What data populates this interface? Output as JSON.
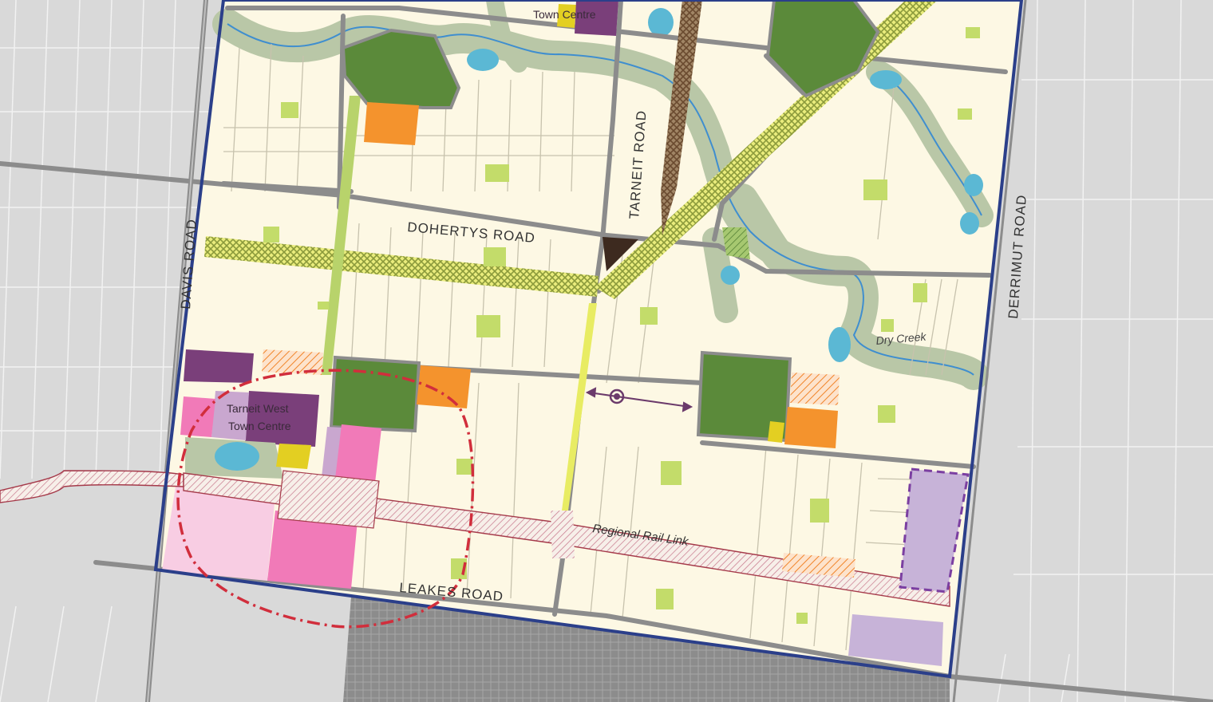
{
  "map": {
    "roads": {
      "dohertys": "DOHERTYS  ROAD",
      "tarneit": "TARNEIT ROAD",
      "davis": "DAVIS ROAD",
      "derrimut": "DERRIMUT ROAD",
      "leakes": "LEAKES ROAD"
    },
    "rail_label": "Regional Rail Link",
    "creek_label": "Dry Creek",
    "town_centre_north": {
      "line1": "",
      "line2": "Town Centre"
    },
    "town_centre_west": {
      "line1": "Tarneit West",
      "line2": "Town Centre"
    },
    "colors": {
      "background": "#d9d9d9",
      "land": "#fdf8e4",
      "road": "#8c8c8c",
      "boundary": "#2b3f8a",
      "open_space": "#5b8a3a",
      "local_park": "#c3dc6a",
      "waterway_corridor": "#b9c7a7",
      "water": "#5bb8d4",
      "school": "#f4932d",
      "town_centre": "#7a3f7a",
      "commercial": "#f17ab8",
      "mixed_use": "#f8cde3",
      "conservation_corridor": "#e0e36a",
      "rail_hatch": "#b7485a",
      "residential_existing": "#8f8f8f",
      "purple_future": "#c7b3d8",
      "brown_corridor": "#8a6a4f",
      "walkable_catchment": "#d12e3c"
    }
  }
}
